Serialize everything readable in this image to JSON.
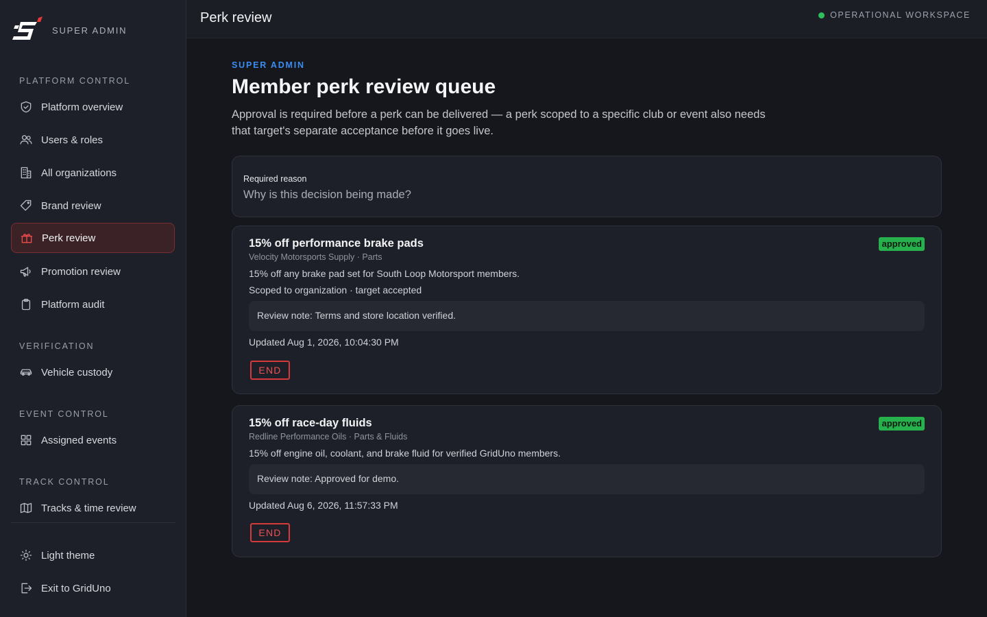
{
  "brand": {
    "label": "SUPER ADMIN",
    "logo_icon": "gridUno-logo"
  },
  "sidebar": {
    "sections": [
      {
        "label": "PLATFORM CONTROL"
      },
      {
        "label": "VERIFICATION"
      },
      {
        "label": "EVENT CONTROL"
      },
      {
        "label": "TRACK CONTROL"
      }
    ],
    "items": [
      {
        "label": "Platform overview",
        "icon": "shield-check-icon"
      },
      {
        "label": "Users & roles",
        "icon": "users-icon"
      },
      {
        "label": "All organizations",
        "icon": "building-icon"
      },
      {
        "label": "Brand review",
        "icon": "tag-icon"
      },
      {
        "label": "Perk review",
        "icon": "gift-icon",
        "active": true
      },
      {
        "label": "Promotion review",
        "icon": "megaphone-icon"
      },
      {
        "label": "Platform audit",
        "icon": "clipboard-icon"
      },
      {
        "label": "Vehicle custody",
        "icon": "car-icon"
      },
      {
        "label": "Assigned events",
        "icon": "grid-icon"
      },
      {
        "label": "Tracks & time review",
        "icon": "map-icon"
      }
    ],
    "footer": [
      {
        "label": "Light theme",
        "icon": "sun-icon"
      },
      {
        "label": "Exit to GridUno",
        "icon": "exit-icon"
      }
    ]
  },
  "topbar": {
    "title": "Perk review",
    "workspace": "OPERATIONAL WORKSPACE",
    "status_color": "#2fbf5a"
  },
  "main": {
    "eyebrow": "SUPER ADMIN",
    "title": "Member perk review queue",
    "description": "Approval is required before a perk can be delivered — a perk scoped to a specific club or event also needs that target's separate acceptance before it goes live.",
    "reason": {
      "label": "Required reason",
      "placeholder": "Why is this decision being made?",
      "value": ""
    },
    "perks": [
      {
        "title": "15% off performance brake pads",
        "subtitle": "Velocity Motorsports Supply · Parts",
        "description": "15% off any brake pad set for South Loop Motorsport members.",
        "scope": "Scoped to organization · target accepted",
        "note": "Review note: Terms and store location verified.",
        "updated": "Updated Aug 1, 2026, 10:04:30 PM",
        "status": "approved",
        "action": "END"
      },
      {
        "title": "15% off race-day fluids",
        "subtitle": "Redline Performance Oils · Parts & Fluids",
        "description": "15% off engine oil, coolant, and brake fluid for verified GridUno members.",
        "note": "Review note: Approved for demo.",
        "updated": "Updated Aug 6, 2026, 11:57:33 PM",
        "status": "approved",
        "action": "END"
      }
    ]
  },
  "colors": {
    "accent_red": "#ef4b4b",
    "accent_blue": "#3b8cf0",
    "approved_green": "#27b14d"
  }
}
